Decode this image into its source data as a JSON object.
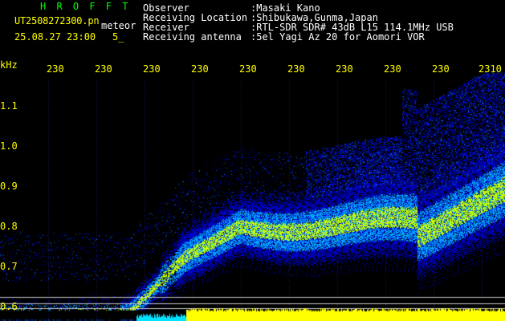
{
  "header": {
    "title": "H R O F F T",
    "file_name": "UT2508272300.pn",
    "tag": "meteor",
    "date_time": "25.08.27 23:00",
    "speed": "5_"
  },
  "info": [
    {
      "label": "Observer",
      "value": ":Masaki Kano"
    },
    {
      "label": "Receiving Location",
      "value": ":Shibukawa,Gunma,Japan"
    },
    {
      "label": "Receiver",
      "value": ":RTL-SDR SDR# 43dB L15 114.1MHz USB"
    },
    {
      "label": "Receiving antenna",
      "value": ":5el Yagi Az 20 for Aomori VOR"
    }
  ],
  "axes": {
    "freq_unit": "kHz",
    "time_ticks": [
      "230",
      "230",
      "230",
      "230",
      "230",
      "230",
      "230",
      "230",
      "230",
      "2310"
    ],
    "freq_ticks": [
      "1.1",
      "1.0",
      "0.9",
      "0.8",
      "0.7",
      "0.6"
    ]
  },
  "colors": {
    "background": "#000000",
    "title": "#00ff00",
    "tick": "#ffff00",
    "info_text": "#ffffff",
    "signal_low": "#0000c8",
    "signal_mid": "#00aaff",
    "signal_high": "#c8ff00",
    "baseline": "#ffff00"
  }
}
